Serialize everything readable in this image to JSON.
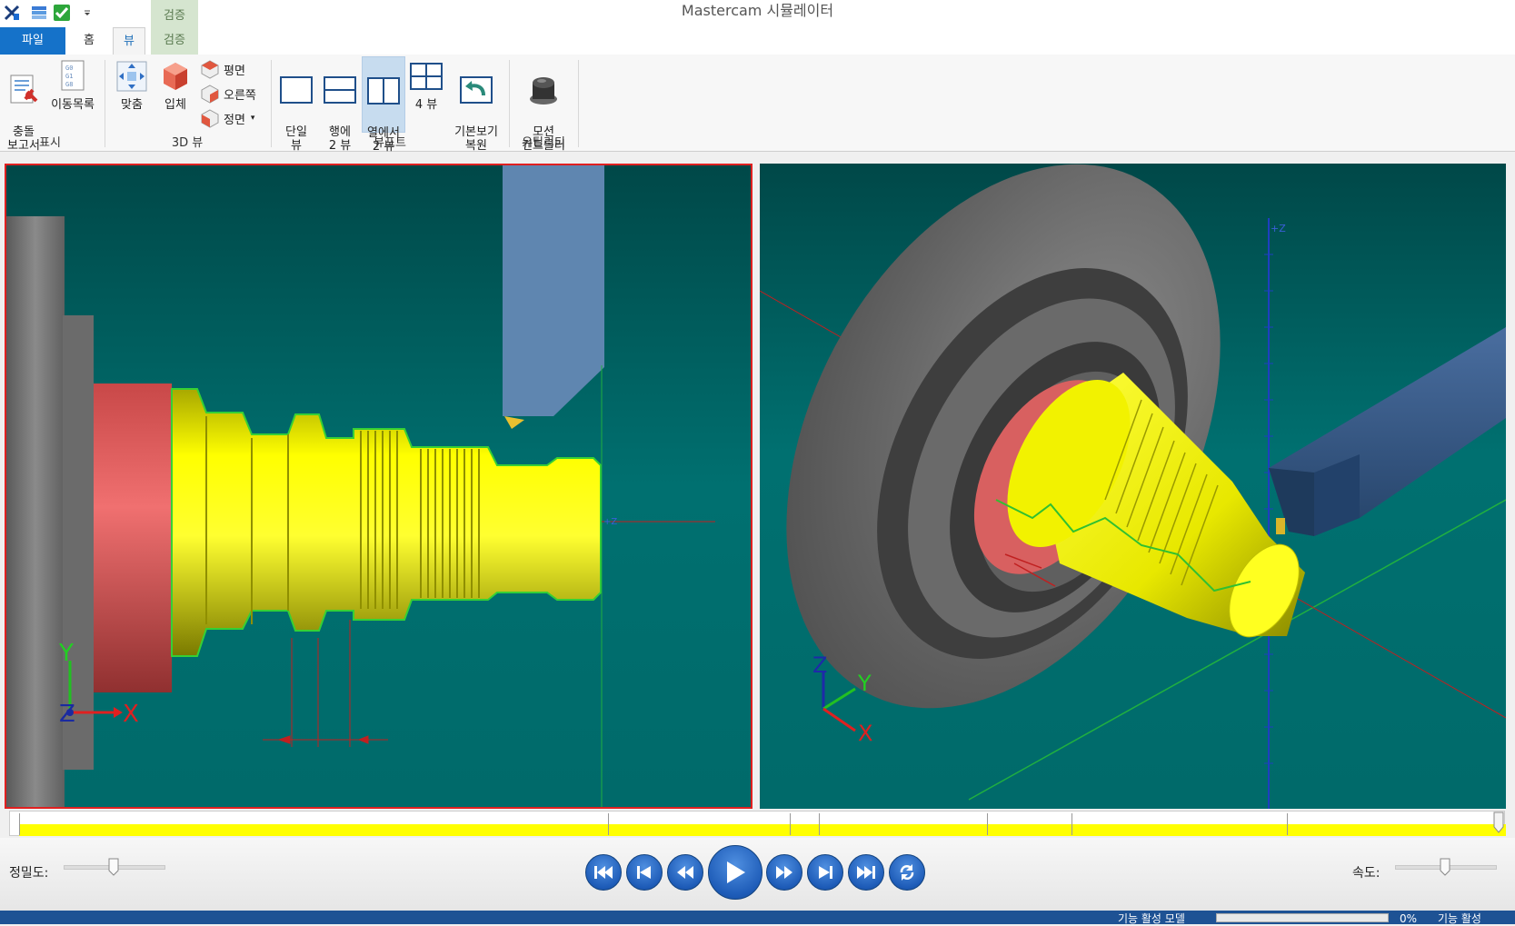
{
  "window": {
    "title": "Mastercam 시뮬레이터"
  },
  "quick_access": [
    "x-logo-icon",
    "layers-icon",
    "check-icon",
    "dropdown-arrow-icon"
  ],
  "context_group": {
    "label": "검증",
    "color": "#d5e5cf"
  },
  "tabs": [
    {
      "label": "파일"
    },
    {
      "label": "홈"
    },
    {
      "label": "뷰"
    },
    {
      "label": "검증"
    }
  ],
  "ribbon": {
    "display": {
      "label": "표시",
      "collision_report": "충돌\n보고서",
      "move_list": "이동목록"
    },
    "view3d": {
      "label": "3D 뷰",
      "fit": "맞춤",
      "solid": "입체",
      "top": "평면",
      "right": "오른쪽",
      "front": "정면"
    },
    "viewport": {
      "label": "뷰포트",
      "single": "단일\n뷰",
      "rows2": "행에\n2 뷰",
      "cols2": "열에서\n2 뷰",
      "four": "4 뷰",
      "reset": "기본보기\n복원"
    },
    "utility": {
      "label": "유틸리티",
      "motion": "모션\n컨트롤러"
    }
  },
  "viewports": {
    "left": {
      "z_label": "+Z",
      "axes": {
        "x": "X",
        "y": "Y",
        "z": "Z"
      }
    },
    "right": {
      "z_label": "+Z",
      "axes": {
        "x": "X",
        "y": "Y",
        "z": "Z"
      }
    }
  },
  "colors": {
    "viewport_bg": "#007070",
    "part_yellow": "#ffff00",
    "stock_red": "#d86060",
    "chuck_gray": "#707070",
    "tool_blue": "#5f86b0",
    "active_viewport_border": "#e02020",
    "play_blue": "#1e5cb8"
  },
  "controls": {
    "precision_label": "정밀도:",
    "speed_label": "속도:",
    "precision_level": 0.5,
    "speed_level": 0.5,
    "buttons": [
      "skip-to-start-icon",
      "step-back-icon",
      "rewind-icon",
      "play-icon",
      "fast-forward-icon",
      "step-forward-icon",
      "skip-to-end-icon",
      "loop-icon"
    ]
  },
  "status": {
    "text": "기능 활성 모델",
    "percent": "0%",
    "text2": "기능 활성 "
  }
}
